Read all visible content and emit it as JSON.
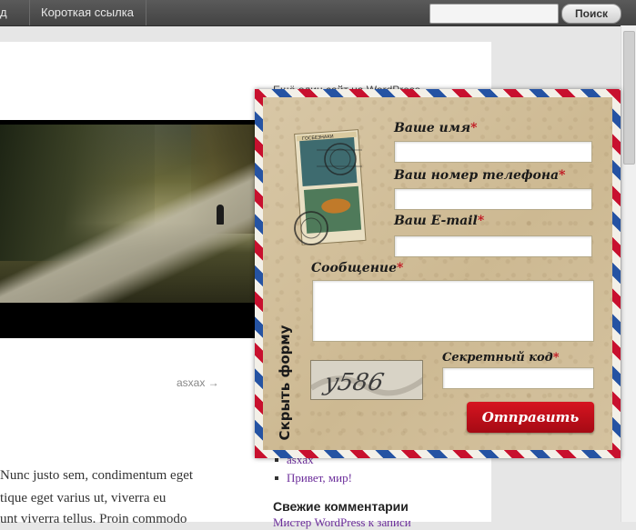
{
  "adminbar": {
    "left_fragment": "д",
    "shortlink_label": "Короткая ссылка",
    "search_placeholder": "",
    "search_button": "Поиск"
  },
  "page": {
    "blog_description": "Ещё один сайт на WordPress",
    "next_post_link": "asxax →",
    "body_lines": [
      "Nunc justo sem, condimentum eget",
      "tique eget varius ut, viverra eu",
      "unt viverra tellus. Proin commodo"
    ],
    "sidebar_links": [
      "asxax",
      "Привет, мир!"
    ],
    "recent_comments_heading": "Свежие комментарии",
    "recent_comment_item": "Мистер WordPress к записи"
  },
  "form": {
    "name_label": "Ваше имя",
    "phone_label": "Ваш номер телефона",
    "email_label": "Ваш E-mail",
    "message_label": "Сообщение",
    "secret_code_label": "Секретный код",
    "required_mark": "*",
    "captcha_text": "y586",
    "submit_label": "Отправить",
    "hide_form_label": "Скрыть форму",
    "stamp_text": "ГОСБЕЗНАКИ",
    "colors": {
      "stripe_red": "#c8102e",
      "stripe_blue": "#2553a3",
      "paper": "#d4c29f",
      "button_red": "#c0101c"
    }
  }
}
